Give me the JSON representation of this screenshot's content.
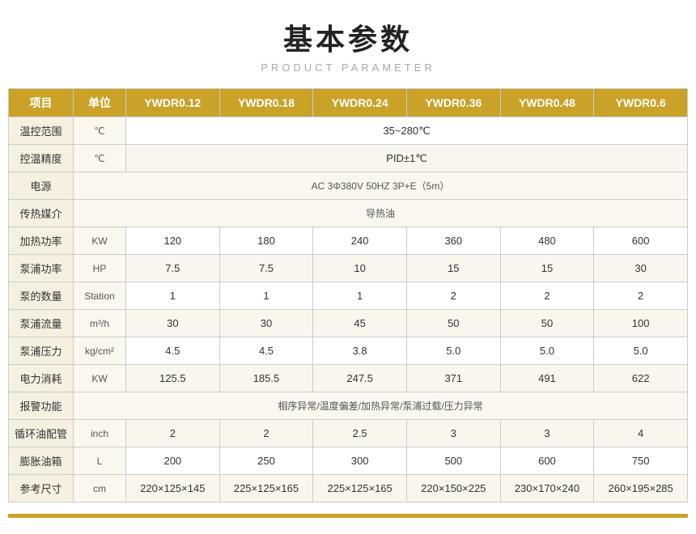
{
  "header": {
    "title": "基本参数",
    "subtitle": "PRODUCT PARAMETER"
  },
  "table": {
    "columns": [
      "项目",
      "单位",
      "YWDR0.12",
      "YWDR0.18",
      "YWDR0.24",
      "YWDR0.36",
      "YWDR0.48",
      "YWDR0.6"
    ],
    "rows": [
      {
        "label": "温控范围",
        "unit": "℃",
        "values": [
          "35~280℃"
        ],
        "span": true
      },
      {
        "label": "控温精度",
        "unit": "℃",
        "values": [
          "PID±1℃"
        ],
        "span": true
      },
      {
        "label": "电源",
        "unit": "",
        "values": [
          "AC 3Φ380V 50HZ 3P+E（5m）"
        ],
        "span": true,
        "spanFrom": 2
      },
      {
        "label": "传热媒介",
        "unit": "",
        "values": [
          "导热油"
        ],
        "span": true,
        "spanFrom": 2
      },
      {
        "label": "加热功率",
        "unit": "KW",
        "values": [
          "120",
          "180",
          "240",
          "360",
          "480",
          "600"
        ],
        "span": false
      },
      {
        "label": "泵浦功率",
        "unit": "HP",
        "values": [
          "7.5",
          "7.5",
          "10",
          "15",
          "15",
          "30"
        ],
        "span": false
      },
      {
        "label": "泵的数量",
        "unit": "Station",
        "values": [
          "1",
          "1",
          "1",
          "2",
          "2",
          "2"
        ],
        "span": false
      },
      {
        "label": "泵浦流量",
        "unit": "m³/h",
        "values": [
          "30",
          "30",
          "45",
          "50",
          "50",
          "100"
        ],
        "span": false
      },
      {
        "label": "泵浦压力",
        "unit": "kg/cm²",
        "values": [
          "4.5",
          "4.5",
          "3.8",
          "5.0",
          "5.0",
          "5.0"
        ],
        "span": false
      },
      {
        "label": "电力消耗",
        "unit": "KW",
        "values": [
          "125.5",
          "185.5",
          "247.5",
          "371",
          "491",
          "622"
        ],
        "span": false
      },
      {
        "label": "报警功能",
        "unit": "",
        "values": [
          "相序异常/温度偏差/加热异常/泵浦过载/压力异常"
        ],
        "span": true,
        "spanFrom": 2
      },
      {
        "label": "循环油配管",
        "unit": "inch",
        "values": [
          "2",
          "2",
          "2.5",
          "3",
          "3",
          "4"
        ],
        "span": false
      },
      {
        "label": "膨胀油箱",
        "unit": "L",
        "values": [
          "200",
          "250",
          "300",
          "500",
          "600",
          "750"
        ],
        "span": false
      },
      {
        "label": "参考尺寸",
        "unit": "cm",
        "values": [
          "220×125×145",
          "225×125×165",
          "225×125×165",
          "220×150×225",
          "230×170×240",
          "260×195×285"
        ],
        "span": false
      }
    ]
  }
}
